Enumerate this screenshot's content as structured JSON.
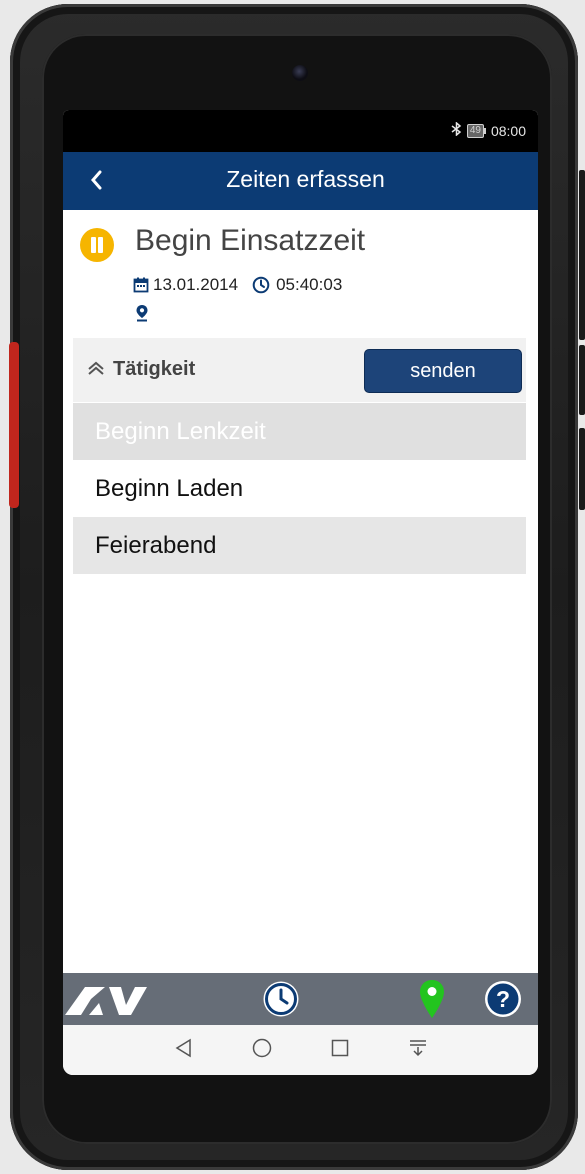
{
  "status_bar": {
    "battery_level": "49",
    "time": "08:00"
  },
  "app_bar": {
    "title": "Zeiten erfassen",
    "back_icon": "chevron-left-icon"
  },
  "entry": {
    "title": "Begin Einsatzzeit",
    "date": "13.01.2014",
    "time": "05:40:03",
    "status_icon": "pause-icon",
    "accent_color": "#f6b500"
  },
  "activity_section": {
    "label": "Tätigkeit",
    "send_label": "senden",
    "items": [
      {
        "label": "Beginn Lenkzeit",
        "state": "disabled"
      },
      {
        "label": "Beginn Laden",
        "state": "normal"
      },
      {
        "label": "Feierabend",
        "state": "normal"
      }
    ]
  },
  "bottom_bar": {
    "icons": [
      "av-logo",
      "clock-icon",
      "location-pin-icon",
      "help-icon"
    ],
    "location_color": "#23c41f",
    "primary_color": "#0c3b74"
  },
  "nav_bar": {
    "icons": [
      "back-icon",
      "home-icon",
      "recents-icon",
      "notifications-icon"
    ]
  }
}
